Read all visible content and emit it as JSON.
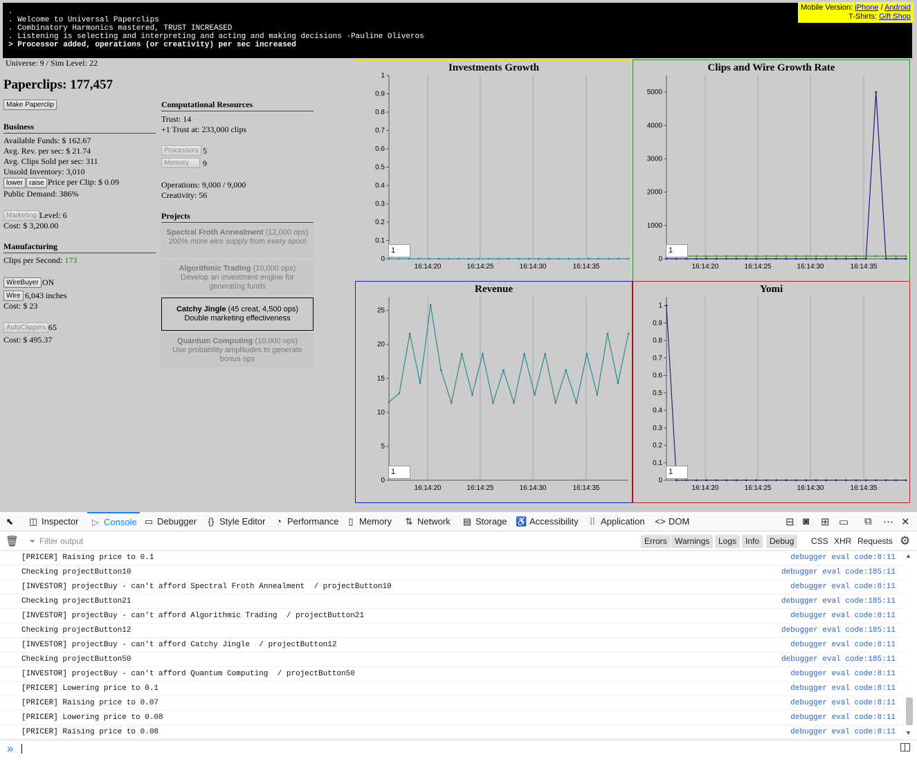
{
  "top_console": {
    "lines": [
      ".",
      ". Welcome to Universal Paperclips",
      ". Combinatory Harmonics mastered, TRUST INCREASED",
      ". Listening is selecting and interpreting and acting and making decisions -Pauline Oliveros",
      "> Processor added, operations (or creativity) per sec increased"
    ]
  },
  "promo": {
    "mobile_label": "Mobile Version:",
    "iphone": "iPhone",
    "sep": "/",
    "android": "Android",
    "tshirts_label": "T-Shirts:",
    "gift_shop": "Gift Shop"
  },
  "status": {
    "universe": "Universe: 9 / Sim Level: 22"
  },
  "paperclips": {
    "label": "Paperclips: 177,457",
    "make_button": "Make Paperclip"
  },
  "business": {
    "title": "Business",
    "funds": "Available Funds: $ 162.67",
    "rev": "Avg. Rev. per sec: $ 21.74",
    "sold": "Avg. Clips Sold per sec: 311",
    "inventory": "Unsold Inventory: 3,010",
    "lower": "lower",
    "raise": "raise",
    "price": "Price per Clip: $ 0.09",
    "demand": "Public Demand: 386%",
    "marketing_button": "Marketing",
    "marketing_level": "Level: 6",
    "marketing_cost": "Cost: $ 3,200.00"
  },
  "manufacturing": {
    "title": "Manufacturing",
    "cps_label": "Clips per Second:",
    "cps_value": "173",
    "wirebuyer_button": "WireBuyer",
    "wirebuyer_state": "ON",
    "wire_button": "Wire",
    "wire_amount": "6,043 inches",
    "wire_cost": "Cost: $ 23",
    "autoclippers_button": "AutoClippers",
    "autoclippers_count": "65",
    "autoclippers_cost": "Cost: $ 495.37"
  },
  "computational": {
    "title": "Computational Resources",
    "trust": "Trust: 14",
    "next_trust": "+1 Trust at: 233,000 clips",
    "processors_button": "Processors",
    "processors_value": "5",
    "memory_button": "Memory",
    "memory_value": "9",
    "operations": "Operations: 9,000 / 9,000",
    "creativity": "Creativity: 56"
  },
  "projects": {
    "title": "Projects",
    "items": [
      {
        "name": "Spectral Froth Annealment",
        "cost": " (12,000 ops)",
        "desc": "200% more wire supply from every spool"
      },
      {
        "name": "Algorithmic Trading",
        "cost": " (10,000 ops)",
        "desc": "Develop an investment engine for generating funds"
      },
      {
        "name": "Catchy Jingle",
        "cost": " (45 creat, 4,500 ops)",
        "desc": "Double marketing effectiveness"
      },
      {
        "name": "Quantum Computing",
        "cost": " (10,000 ops)",
        "desc": "Use probability amplitudes to generate bonus ops"
      }
    ]
  },
  "colors": {
    "investments_border": "#e6e600",
    "clips_border": "#2e8b2e",
    "revenue_border": "#1a1acc",
    "yomi_border": "#cc2222",
    "revenue_line": "#2a8c8c",
    "clips_line": "#1a1a8c",
    "wire_line": "#2e9a2e",
    "yomi_line": "#1a2a6c",
    "devtools_accent": "#0a84ff"
  },
  "chart_data": [
    {
      "type": "line",
      "title": "Investments Growth",
      "x": [
        "16:14:20",
        "16:14:25",
        "16:14:30",
        "16:14:35"
      ],
      "ylim": [
        0,
        1
      ],
      "yticks": [
        0,
        0.1,
        0.2,
        0.3,
        0.4,
        0.5,
        0.6,
        0.7,
        0.8,
        0.9,
        1
      ],
      "ytick_labels": [
        "0",
        "0.1",
        "0.2",
        "0.3",
        "0.4",
        "0.5",
        "0.6",
        "0.7",
        "0.8",
        "0.9",
        "1"
      ],
      "input_value": "1",
      "series": [
        {
          "color": "#2a8c8c",
          "values": [
            0,
            0,
            0,
            0,
            0,
            0,
            0,
            0,
            0,
            0,
            0,
            0,
            0,
            0,
            0,
            0,
            0,
            0,
            0,
            0,
            0,
            0,
            0,
            0,
            0
          ]
        }
      ],
      "grid": true
    },
    {
      "type": "line",
      "title": "Clips and Wire Growth Rate",
      "x": [
        "16:14:20",
        "16:14:25",
        "16:14:30",
        "16:14:35"
      ],
      "ylim": [
        0,
        5500
      ],
      "yticks": [
        0,
        1000,
        2000,
        3000,
        4000,
        5000
      ],
      "ytick_labels": [
        "0",
        "1000",
        "2000",
        "3000",
        "4000",
        "5000"
      ],
      "input_value": "1",
      "series": [
        {
          "color": "#1a1a8c",
          "values": [
            0,
            0,
            0,
            0,
            0,
            0,
            0,
            0,
            0,
            0,
            0,
            0,
            0,
            0,
            0,
            0,
            0,
            0,
            0,
            0,
            0,
            5000,
            0,
            0,
            0
          ]
        },
        {
          "color": "#2e9a2e",
          "values": [
            80,
            80,
            80,
            80,
            80,
            80,
            80,
            80,
            80,
            80,
            80,
            80,
            80,
            80,
            80,
            80,
            80,
            80,
            80,
            80,
            80,
            80,
            80,
            80,
            80
          ]
        }
      ],
      "grid": true
    },
    {
      "type": "line",
      "title": "Revenue",
      "x": [
        "16:14:20",
        "16:14:25",
        "16:14:30",
        "16:14:35"
      ],
      "ylim": [
        0,
        27
      ],
      "yticks": [
        0,
        5,
        10,
        15,
        20,
        25
      ],
      "ytick_labels": [
        "0",
        "5",
        "10",
        "15",
        "20",
        "25"
      ],
      "input_value": "1",
      "series": [
        {
          "color": "#2a8c8c",
          "values": [
            11.5,
            12.8,
            21.6,
            14.3,
            25.8,
            16.2,
            11.4,
            18.6,
            12.6,
            18.6,
            11.4,
            16.2,
            11.4,
            18.6,
            12.6,
            18.6,
            11.4,
            16.2,
            11.4,
            18.6,
            12.6,
            21.6,
            14.3,
            21.6
          ]
        }
      ],
      "grid": true
    },
    {
      "type": "line",
      "title": "Yomi",
      "x": [
        "16:14:20",
        "16:14:25",
        "16:14:30",
        "16:14:35"
      ],
      "ylim": [
        0,
        1.05
      ],
      "yticks": [
        0,
        0.1,
        0.2,
        0.3,
        0.4,
        0.5,
        0.6,
        0.7,
        0.8,
        0.9,
        1
      ],
      "ytick_labels": [
        "0",
        "0.1",
        "0.2",
        "0.3",
        "0.4",
        "0.5",
        "0.6",
        "0.7",
        "0.8",
        "0.9",
        "1"
      ],
      "input_value": "1",
      "series": [
        {
          "color": "#1a2a6c",
          "values": [
            1,
            0,
            0,
            0,
            0,
            0,
            0,
            0,
            0,
            0,
            0,
            0,
            0,
            0,
            0,
            0,
            0,
            0,
            0,
            0,
            0,
            0,
            0,
            0,
            0
          ]
        }
      ],
      "grid": true
    }
  ],
  "devtools": {
    "tabs": [
      {
        "name": "picker",
        "label": "",
        "icon": "⬉"
      },
      {
        "name": "inspector",
        "label": "Inspector",
        "icon": "◫"
      },
      {
        "name": "console",
        "label": "Console",
        "icon": "▷"
      },
      {
        "name": "debugger",
        "label": "Debugger",
        "icon": "▭"
      },
      {
        "name": "style-editor",
        "label": "Style Editor",
        "icon": "{}"
      },
      {
        "name": "performance",
        "label": "Performance",
        "icon": "◔"
      },
      {
        "name": "memory",
        "label": "Memory",
        "icon": "▯"
      },
      {
        "name": "network",
        "label": "Network",
        "icon": "⇅"
      },
      {
        "name": "storage",
        "label": "Storage",
        "icon": "▤"
      },
      {
        "name": "accessibility",
        "label": "Accessibility",
        "icon": "♿"
      },
      {
        "name": "application",
        "label": "Application",
        "icon": "⁞⁞"
      },
      {
        "name": "dom",
        "label": "DOM",
        "icon": "<>"
      }
    ],
    "filter_placeholder": "Filter output",
    "filters": [
      "Errors",
      "Warnings",
      "Logs",
      "Info",
      "Debug"
    ],
    "net_filters": [
      "CSS",
      "XHR",
      "Requests"
    ],
    "log": [
      {
        "msg": "[PRICER] Raising price to 0.1",
        "src": "debugger eval code:8:11"
      },
      {
        "msg": "Checking projectButton10",
        "src": "debugger eval code:185:11"
      },
      {
        "msg": "[INVESTOR] projectBuy - can't afford Spectral Froth Annealment  / projectButton10",
        "src": "debugger eval code:8:11"
      },
      {
        "msg": "Checking projectButton21",
        "src": "debugger eval code:185:11"
      },
      {
        "msg": "[INVESTOR] projectBuy - can't afford Algorithmic Trading  / projectButton21",
        "src": "debugger eval code:8:11"
      },
      {
        "msg": "Checking projectButton12",
        "src": "debugger eval code:185:11"
      },
      {
        "msg": "[INVESTOR] projectBuy - can't afford Catchy Jingle  / projectButton12",
        "src": "debugger eval code:8:11"
      },
      {
        "msg": "Checking projectButton50",
        "src": "debugger eval code:185:11"
      },
      {
        "msg": "[INVESTOR] projectBuy - can't afford Quantum Computing  / projectButton50",
        "src": "debugger eval code:8:11"
      },
      {
        "msg": "[PRICER] Lowering price to 0.1",
        "src": "debugger eval code:8:11"
      },
      {
        "msg": "[PRICER] Raising price to 0.07",
        "src": "debugger eval code:8:11"
      },
      {
        "msg": "[PRICER] Lowering price to 0.08",
        "src": "debugger eval code:8:11"
      },
      {
        "msg": "[PRICER] Raising price to 0.08",
        "src": "debugger eval code:8:11"
      }
    ],
    "prompt_symbol": "»"
  }
}
